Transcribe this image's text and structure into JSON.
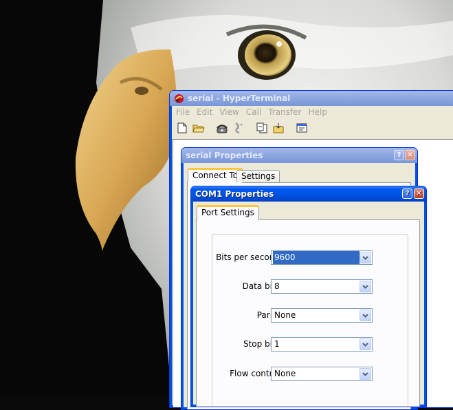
{
  "hyperterminal": {
    "title": "serial - HyperTerminal",
    "menu": [
      "File",
      "Edit",
      "View",
      "Call",
      "Transfer",
      "Help"
    ],
    "toolbar_icons": [
      "new-document-icon",
      "open-folder-icon",
      "phone-connect-icon",
      "phone-disconnect-icon",
      "send-file-icon",
      "receive-file-icon",
      "properties-icon"
    ]
  },
  "serial_properties": {
    "title": "serial Properties",
    "tabs": [
      "Connect To",
      "Settings"
    ],
    "help_btn": "?",
    "close_btn": "✕"
  },
  "com1_properties": {
    "title": "COM1 Properties",
    "help_btn": "?",
    "close_btn": "✕",
    "tab": "Port Settings",
    "fields": [
      {
        "label": "Bits per second:",
        "value": "9600"
      },
      {
        "label": "Data bits:",
        "value": "8"
      },
      {
        "label": "Parity:",
        "value": "None"
      },
      {
        "label": "Stop bits:",
        "value": "1"
      },
      {
        "label": "Flow control:",
        "value": "None"
      }
    ]
  },
  "colors": {
    "active_title": "#0055e5",
    "inactive_title": "#8ea8e0",
    "selection": "#316ac5",
    "tab_highlight": "#ffc83c"
  }
}
